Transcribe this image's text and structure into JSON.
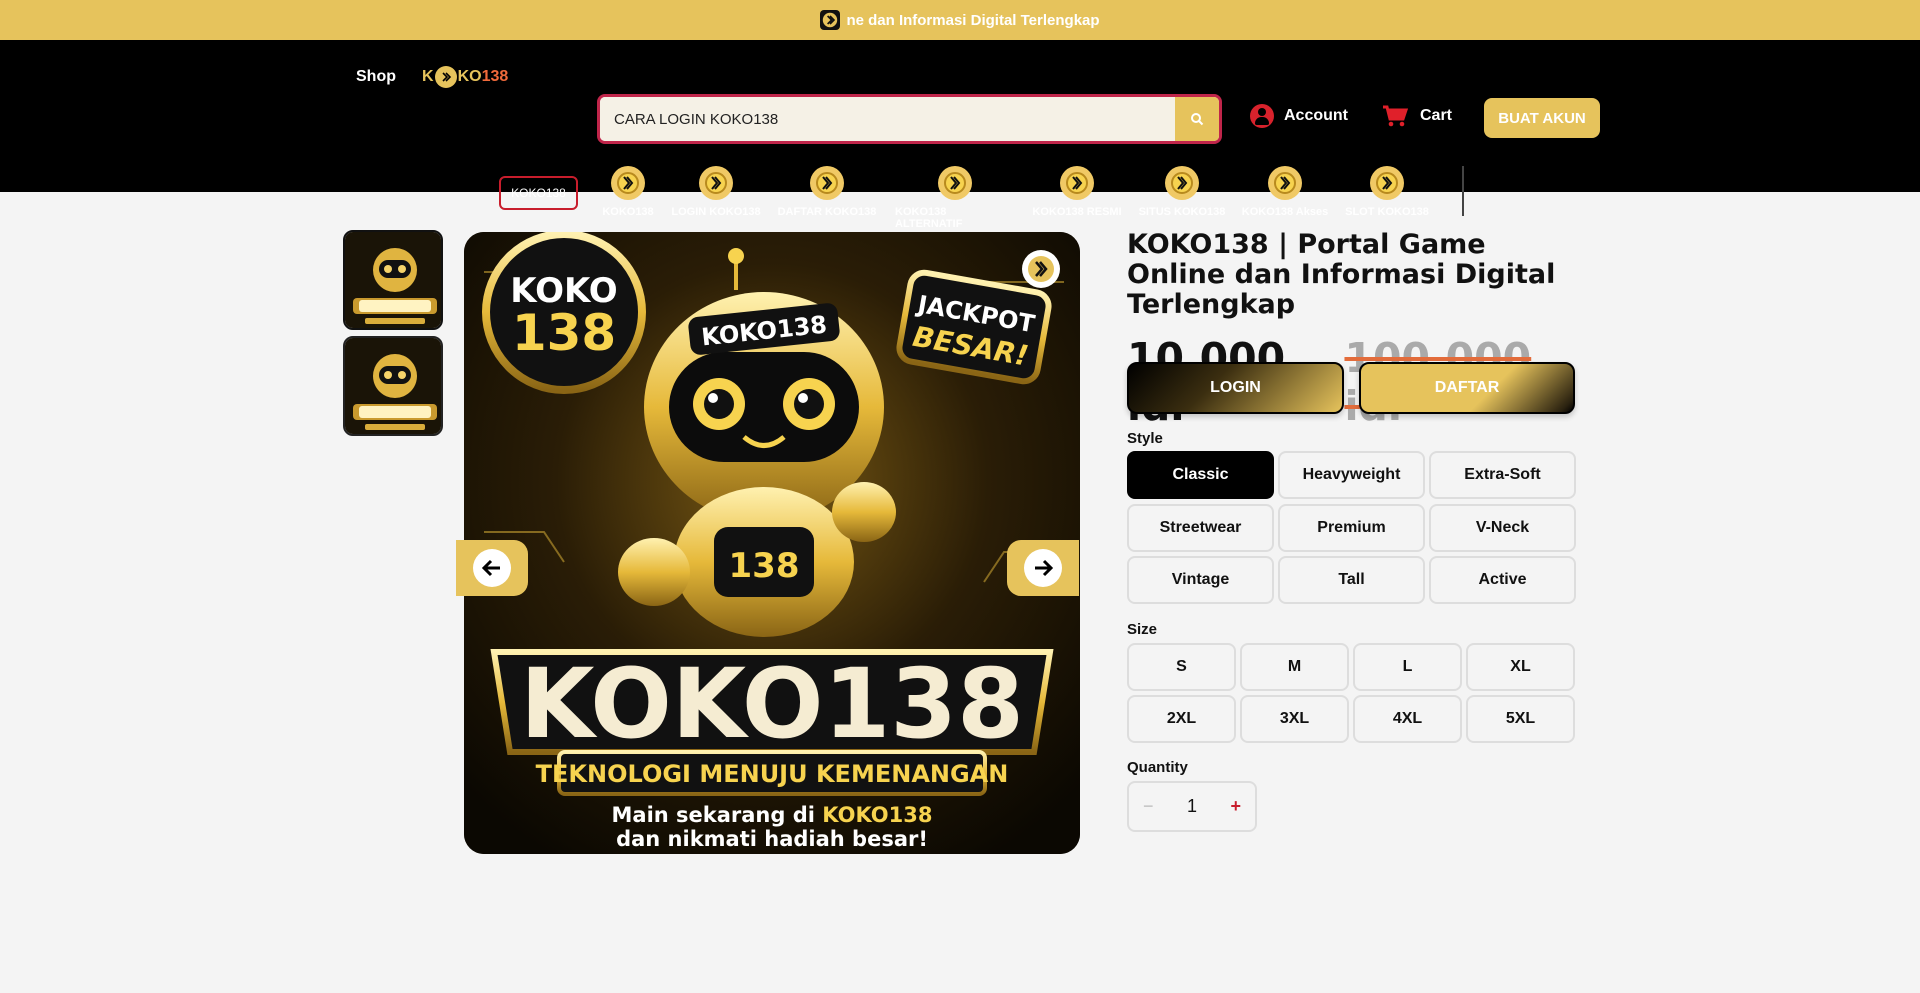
{
  "announcement": {
    "text": "ne dan Informasi Digital Terlengkap"
  },
  "header": {
    "shop_label": "Shop",
    "logo": {
      "prefix": "K",
      "middle": "KO",
      "number": "138"
    },
    "search": {
      "value": "CARA LOGIN KOKO138",
      "placeholder": "CARA LOGIN KOKO138"
    },
    "account_label": "Account",
    "cart_label": "Cart",
    "create_account_label": "BUAT AKUN"
  },
  "categories": {
    "chip_label": "KOKO138",
    "items": [
      {
        "label": "KOKO138"
      },
      {
        "label": "LOGIN KOKO138"
      },
      {
        "label": "DAFTAR KOKO138"
      },
      {
        "label": "KOKO138 ALTERNATIF"
      },
      {
        "label": "KOKO138 RESMI"
      },
      {
        "label": "SITUS KOKO138"
      },
      {
        "label": "KOKO138 Akses"
      },
      {
        "label": "SLOT KOKO138"
      }
    ]
  },
  "product": {
    "title": "KOKO138 | Portal Game Online dan Informasi Digital Terlengkap",
    "price_current": "10.000 idr",
    "price_original": "100.000 idr",
    "login_label": "LOGIN",
    "register_label": "DAFTAR",
    "image": {
      "badge_left_top": "KOKO",
      "badge_left_num": "138",
      "helmet_text": "KOKO138",
      "badge_right_line1": "JACKPOT",
      "badge_right_line2": "BESAR!",
      "chest_number": "138",
      "headline": "KOKO138",
      "tagline": "TEKNOLOGI MENUJU KEMENANGAN",
      "footer_line1_prefix": "Main sekarang di ",
      "footer_line1_brand": "KOKO138",
      "footer_line2": "dan nikmati hadiah besar!"
    },
    "style": {
      "label": "Style",
      "selected": "Classic",
      "options": [
        "Classic",
        "Heavyweight",
        "Extra-Soft",
        "Streetwear",
        "Premium",
        "V-Neck",
        "Vintage",
        "Tall",
        "Active"
      ]
    },
    "size": {
      "label": "Size",
      "options": [
        "S",
        "M",
        "L",
        "XL",
        "2XL",
        "3XL",
        "4XL",
        "5XL"
      ]
    },
    "quantity": {
      "label": "Quantity",
      "value": "1",
      "minus": "−",
      "plus": "+"
    }
  },
  "colors": {
    "gold": "#e6c35c",
    "black": "#000000",
    "red": "#c81d2c",
    "background": "#f4f4f4"
  },
  "icons": [
    "brand-logo-icon",
    "search-icon",
    "account-icon",
    "cart-icon",
    "arrow-left-icon",
    "arrow-right-icon"
  ]
}
